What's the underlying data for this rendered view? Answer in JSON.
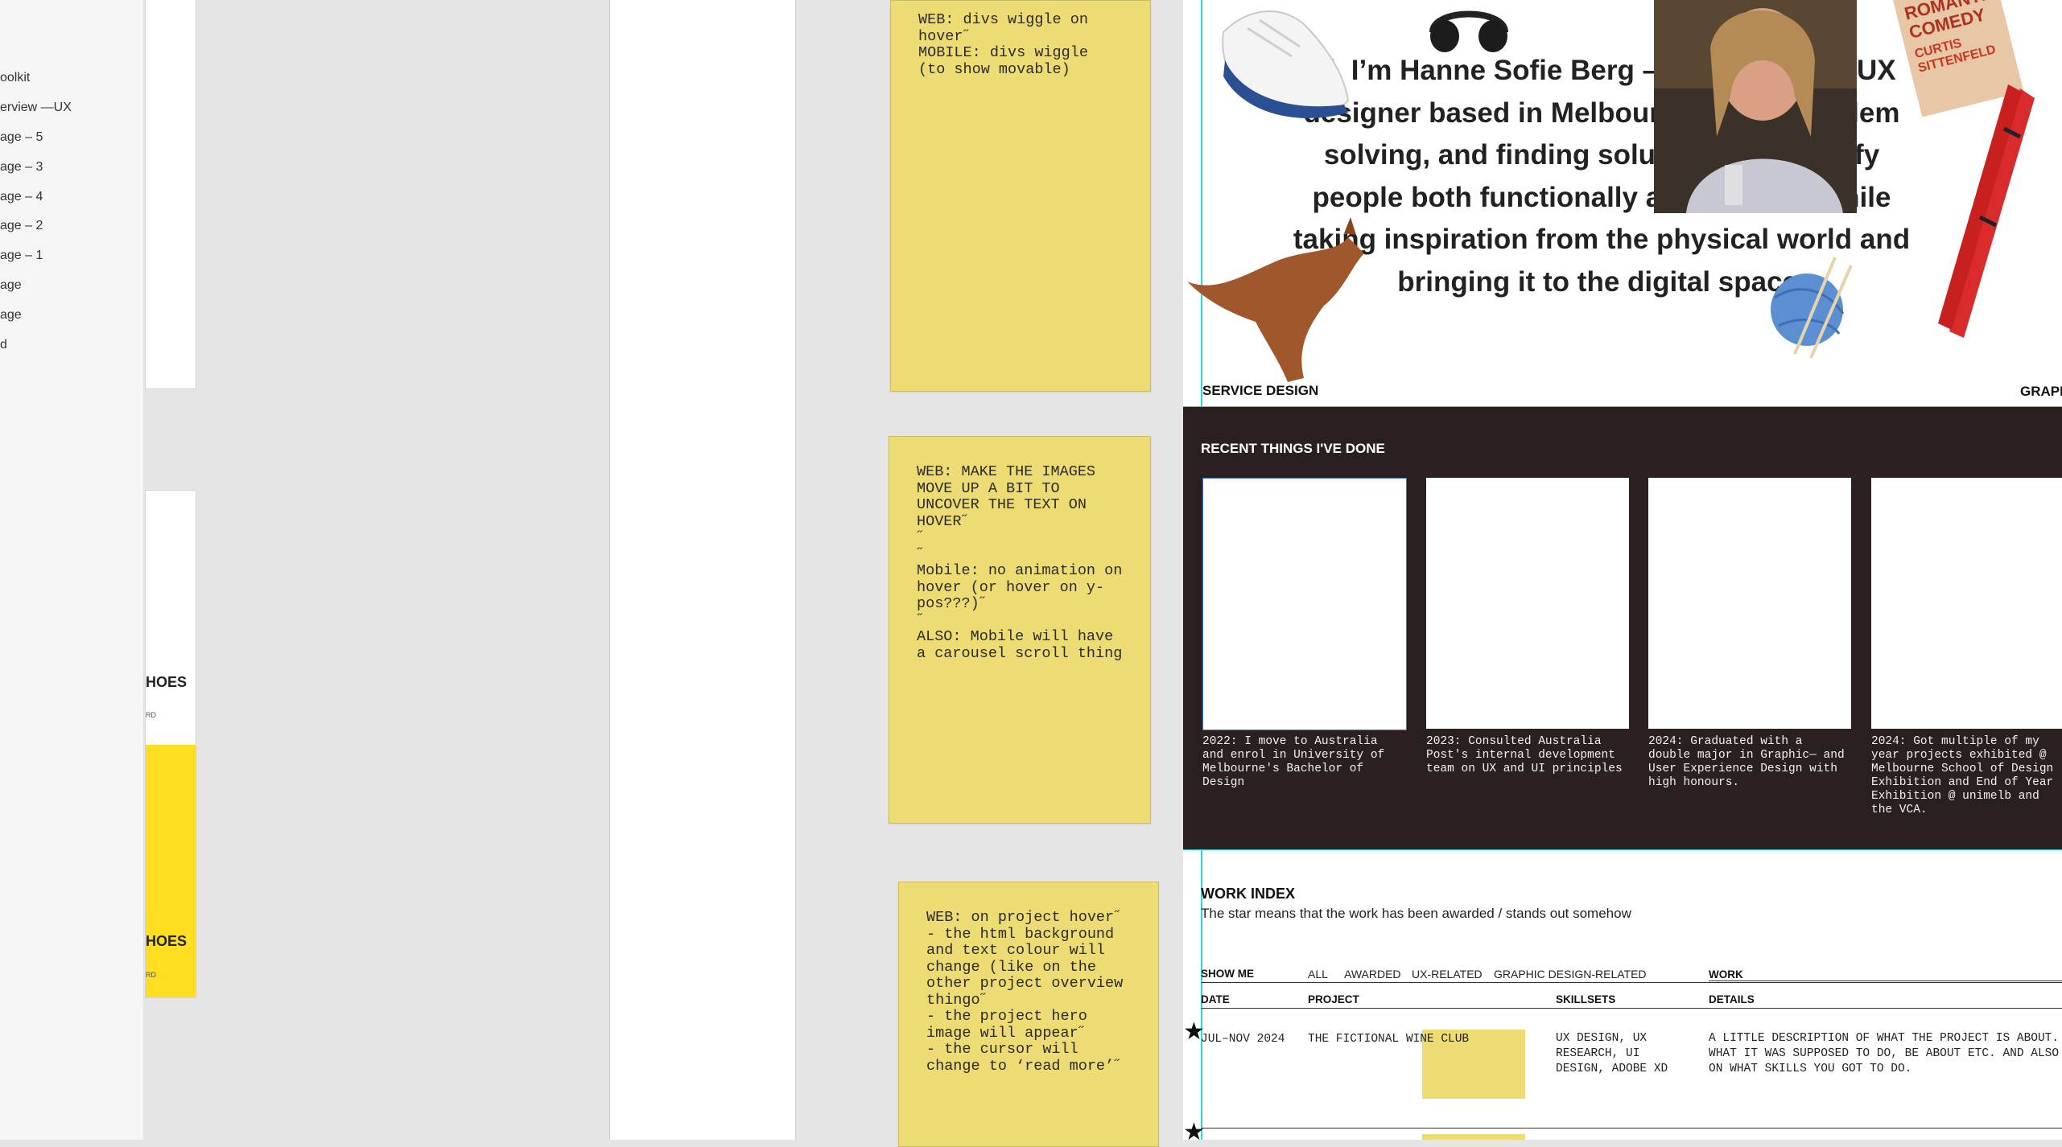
{
  "layers": [
    "oolkit",
    "erview —UX",
    "age – 5",
    "age – 3",
    "age – 4",
    "age – 2",
    "age – 1",
    "age",
    "age",
    "d"
  ],
  "left_frame": {
    "heading_1": "HOES",
    "sub_1": "RD",
    "heading_2": "HOES",
    "sub_2": "RD"
  },
  "stickies": [
    "WEB: divs wiggle on hover˝\nMOBILE: divs wiggle (to show movable)",
    "WEB: MAKE THE IMAGES MOVE UP A BIT TO UNCOVER THE TEXT ON HOVER˝\n˝\n˝\nMobile: no animation on hover (or hover on y-pos???)˝\n˝\nALSO: Mobile will have a carousel scroll thing",
    "WEB: on project hover˝\n- the html background and text colour will change (like on the other project overview thingo˝\n- the project hero image will appear˝\n- the cursor will change to ‘read more’˝"
  ],
  "site": {
    "intro": "Hi, I’m Hanne Sofie Berg – a graphic and UX designer based in Melbourne. I love problem solving, and finding solutions that satisfy people both functionally and visually, while taking inspiration from the physical world and bringing it to the digital space.",
    "book_title_1": "ROMANTIC",
    "book_title_2": "COMEDY",
    "book_author_1": "CURTIS",
    "book_author_2": "SITTENFELD",
    "service_design": "SERVICE DESIGN",
    "graphic_design": "GRAPHIC DESIG",
    "recent_title": "RECENT THINGS I'VE DONE",
    "recent_items": [
      "2022: I move to Australia and enrol in University of Melbourne's Bachelor of Design",
      "2023: Consulted Australia Post's internal development team on UX and UI principles",
      "2024: Graduated with a double major in Graphic— and User Experience Design with high honours.",
      "2024: Got multiple of my year projects exhibited @ Melbourne School of Design Exhibition and End of Year Exhibition @ unimelb and the VCA."
    ],
    "work_index_title": "WORK INDEX",
    "work_index_sub": "The star means that the work has been awarded / stands out somehow",
    "filter_label": "SHOW ME",
    "filters": [
      "ALL",
      "AWARDED",
      "UX-RELATED",
      "GRAPHIC DESIGN-RELATED"
    ],
    "work_col": "WORK",
    "columns": [
      "DATE",
      "PROJECT",
      "SKILLSETS",
      "DETAILS"
    ],
    "row": {
      "date": "JUL–NOV 2024",
      "project": "THE FICTIONAL WINE CLUB",
      "skills": "UX DESIGN, UX RESEARCH, UI DESIGN, ADOBE XD",
      "details": "A LITTLE DESCRIPTION OF WHAT THE PROJECT IS ABOUT. WHAT IT WAS SUPPOSED TO DO, BE ABOUT ETC. AND ALSO ON WHAT SKILLS YOU GOT TO DO."
    },
    "star": "★"
  },
  "colors": {
    "sticky": "#ecdc73",
    "dark_section": "#2a2020",
    "guide": "#2fd6d6",
    "yellow_block": "#ffde21"
  }
}
